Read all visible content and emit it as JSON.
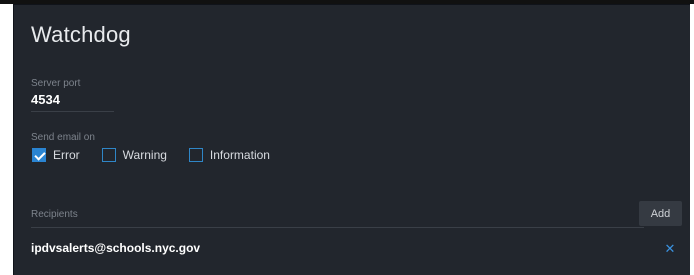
{
  "panel": {
    "title": "Watchdog"
  },
  "server": {
    "port_label": "Server port",
    "port_value": "4534"
  },
  "email": {
    "label": "Send email on",
    "options": [
      {
        "label": "Error",
        "checked": true
      },
      {
        "label": "Warning",
        "checked": false
      },
      {
        "label": "Information",
        "checked": false
      }
    ]
  },
  "recipients": {
    "label": "Recipients",
    "add_label": "Add",
    "items": [
      {
        "email": "ipdvsalerts@schools.nyc.gov"
      }
    ]
  },
  "colors": {
    "panel_background": "#22262d",
    "accent": "#2a84d2",
    "label_text": "#7d838c"
  },
  "icons": {
    "check": "check-icon",
    "remove": "close-icon"
  }
}
